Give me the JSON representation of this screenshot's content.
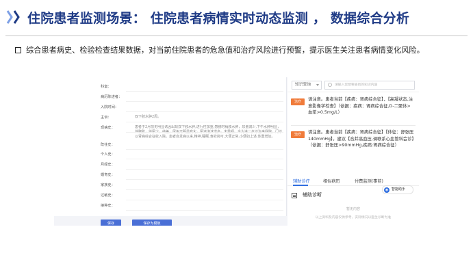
{
  "slide": {
    "title": "住院患者监测场景：  住院患者病情实时动态监测 ，  数据综合分析",
    "bullet": "综合患者病史、检验检查结果数据，对当前住院患者的危急值和治疗风险进行预警，提示医生关注患者病情变化风险。",
    "accent_color": "#1f3b86"
  },
  "screenshot": {
    "form": {
      "rows": [
        {
          "label": "科室：",
          "value": ""
        },
        {
          "label": "病历陈述者：",
          "value": ""
        },
        {
          "label": "入院时间：",
          "value": ""
        },
        {
          "label": "主诉：",
          "value": "双下肢水肿2周。"
        },
        {
          "label": "现病史：",
          "value": "患者于2月前无明显诱因出现双下肢水肿,进行性加重,感腰时稍肢水肿，尿量减少,下午水肿明显，伴腹胀，伴尿少，纳差，尿色无明显变化，尿液泡沫增多，未重视。今为进一步诊治来我院，门诊以肾病综合征收入院。患者自发病以来,精神,睡眠,食欲尚可,大便正常,小便如上述,体重增加。"
        },
        {
          "label": "既往史：",
          "value": ""
        },
        {
          "label": "个人史：",
          "value": ""
        },
        {
          "label": "月经史：",
          "value": ""
        },
        {
          "label": "婚育史：",
          "value": ""
        },
        {
          "label": "家族史：",
          "value": ""
        },
        {
          "label": "过敏史：",
          "value": ""
        },
        {
          "label": "接种史：",
          "value": ""
        }
      ],
      "buttons": [
        "保存",
        "保存为模板"
      ]
    },
    "panel": {
      "select_value": "知识查询",
      "search_placeholder": "请输入您想要查找的知识内容",
      "alerts": [
        {
          "tag": "治疗",
          "text": "请注意。患者当前【疾病：肾病综合征】，【高凝状态,注意影像学检查】（依据：疾病：肾病综合征,D-二聚体>血浆>0.5mg/L）"
        },
        {
          "tag": "治疗",
          "text": "请注意。患者当前【疾病：肾病综合征】【体征：舒张压140mmHg】，建议【合并高血压,调联系心血管科会诊】（依据：舒张压>90mmHg,疾病:肾病综合征）"
        }
      ],
      "tabs": [
        {
          "label": "辅助诊疗",
          "active": true
        },
        {
          "label": "相似病历",
          "active": false
        },
        {
          "label": "付费监测(事前)",
          "active": false
        }
      ],
      "bubble": "智能助手",
      "diag_title": "辅助诊断",
      "empty_title": "暂无内容",
      "empty_note": "以上资料及内容仅供参考，实际情况以医生诊断为准"
    }
  }
}
